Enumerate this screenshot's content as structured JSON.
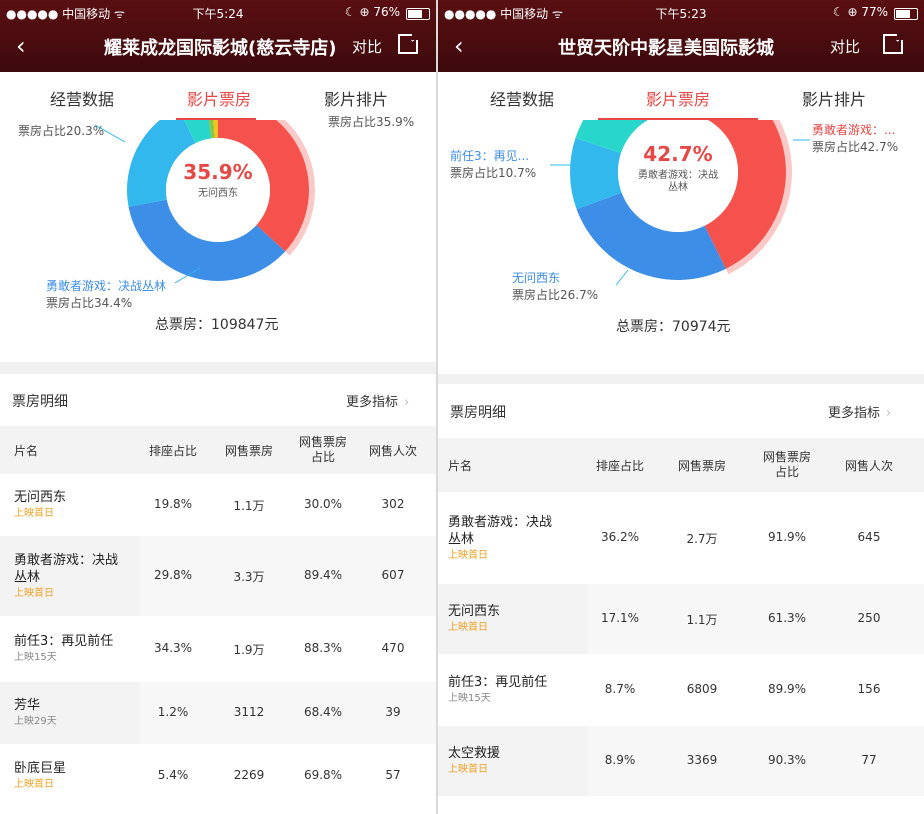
{
  "phones": [
    {
      "status": {
        "carrier": "●●●●● 中国移动 ᯤ",
        "time": "下午5:24",
        "battery": "☾ ⊕ 76%",
        "battery_level": 0.76
      },
      "nav": {
        "back": "‹",
        "title": "耀莱成龙国际影城(慈云寺店)",
        "compare": "对比"
      },
      "tabs": [
        "经营数据",
        "影片票房",
        "影片排片"
      ],
      "active_tab": 1,
      "chart": {
        "center_pct": "35.9%",
        "center_name": "无问西东",
        "callouts": [
          {
            "name": "",
            "share": "票房占比20.3%"
          },
          {
            "name": "",
            "share": "票房占比35.9%"
          },
          {
            "name": "勇敢者游戏：决战丛林",
            "share": "票房占比34.4%"
          }
        ],
        "total": "总票房：109847元",
        "slices": [
          {
            "label": "无问西东",
            "share": 35.9,
            "color": "#f5524d"
          },
          {
            "label": "勇敢者游戏：决战丛林",
            "share": 34.4,
            "color": "#3d8ee6"
          },
          {
            "label": "",
            "share": 20.3,
            "color": "#33b8ee"
          },
          {
            "label": "",
            "share": 5.0,
            "color": "#29d6cc"
          },
          {
            "label": "",
            "share": 1.0,
            "color": "#8cc63f"
          },
          {
            "label": "",
            "share": 1.0,
            "color": "#f3c221"
          }
        ]
      },
      "section": {
        "title": "票房明细",
        "more": "更多指标",
        "more_icon": "chevron-right"
      },
      "columns": [
        "片名",
        "排座占比",
        "网售票房",
        "网售票房占比",
        "网售人次"
      ],
      "rows": [
        {
          "name": [
            "无问西东"
          ],
          "sub": "上映首日",
          "sub_type": "first",
          "seat": "19.8%",
          "box": "1.1万",
          "ratio": "30.0%",
          "people": "302"
        },
        {
          "name": [
            "勇敢者游戏：决战",
            "丛林"
          ],
          "sub": "上映首日",
          "sub_type": "first",
          "seat": "29.8%",
          "box": "3.3万",
          "ratio": "89.4%",
          "people": "607"
        },
        {
          "name": [
            "前任3：再见前任"
          ],
          "sub": "上映15天",
          "sub_type": "old",
          "seat": "34.3%",
          "box": "1.9万",
          "ratio": "88.3%",
          "people": "470"
        },
        {
          "name": [
            "芳华"
          ],
          "sub": "上映29天",
          "sub_type": "old",
          "seat": "1.2%",
          "box": "3112",
          "ratio": "68.4%",
          "people": "39"
        },
        {
          "name": [
            "卧底巨星"
          ],
          "sub": "上映首日",
          "sub_type": "first",
          "seat": "5.4%",
          "box": "2269",
          "ratio": "69.8%",
          "people": "57"
        }
      ]
    },
    {
      "status": {
        "carrier": "●●●●● 中国移动 ᯤ",
        "time": "下午5:23",
        "battery": "☾ ⊕ 77%",
        "battery_level": 0.77
      },
      "nav": {
        "back": "‹",
        "title": "世贸天阶中影星美国际影城",
        "compare": "对比"
      },
      "tabs": [
        "经营数据",
        "影片票房",
        "影片排片"
      ],
      "active_tab": 1,
      "chart": {
        "center_pct": "42.7%",
        "center_name": "勇敢者游戏：决战丛林",
        "callouts": [
          {
            "name": "前任3：再见...",
            "share": "票房占比10.7%"
          },
          {
            "name": "勇敢者游戏：...",
            "share": "票房占比42.7%"
          },
          {
            "name": "无问西东",
            "share": "票房占比26.7%"
          }
        ],
        "total": "总票房：70974元",
        "slices": [
          {
            "label": "勇敢者游戏：决战丛林",
            "share": 42.7,
            "color": "#f5524d"
          },
          {
            "label": "无问西东",
            "share": 26.7,
            "color": "#3d8ee6"
          },
          {
            "label": "前任3：再见前任",
            "share": 10.7,
            "color": "#33b8ee"
          },
          {
            "label": "",
            "share": 10.0,
            "color": "#29d6cc"
          },
          {
            "label": "",
            "share": 9.9,
            "color": "#2bc7d9"
          }
        ]
      },
      "section": {
        "title": "票房明细",
        "more": "更多指标",
        "more_icon": "chevron-right"
      },
      "columns": [
        "片名",
        "排座占比",
        "网售票房",
        "网售票房占比",
        "网售人次"
      ],
      "rows": [
        {
          "name": [
            "勇敢者游戏：决战",
            "丛林"
          ],
          "sub": "上映首日",
          "sub_type": "first",
          "seat": "36.2%",
          "box": "2.7万",
          "ratio": "91.9%",
          "people": "645"
        },
        {
          "name": [
            "无问西东"
          ],
          "sub": "上映首日",
          "sub_type": "first",
          "seat": "17.1%",
          "box": "1.1万",
          "ratio": "61.3%",
          "people": "250"
        },
        {
          "name": [
            "前任3：再见前任"
          ],
          "sub": "上映15天",
          "sub_type": "old",
          "seat": "8.7%",
          "box": "6809",
          "ratio": "89.9%",
          "people": "156"
        },
        {
          "name": [
            "太空救援"
          ],
          "sub": "上映首日",
          "sub_type": "first",
          "seat": "8.9%",
          "box": "3369",
          "ratio": "90.3%",
          "people": "77"
        }
      ]
    }
  ]
}
